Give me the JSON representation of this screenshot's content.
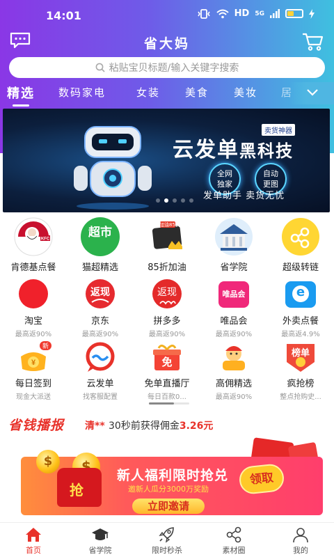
{
  "status_bar": {
    "time": "14:01",
    "network": "HD",
    "signal": "5G"
  },
  "header": {
    "title": "省大妈"
  },
  "search": {
    "placeholder": "粘贴宝贝标题/输入关键字搜索"
  },
  "categories": [
    {
      "label": "精选",
      "active": true
    },
    {
      "label": "数码家电"
    },
    {
      "label": "女装"
    },
    {
      "label": "美食"
    },
    {
      "label": "美妆"
    },
    {
      "label": "居"
    }
  ],
  "banner": {
    "title_a": "云发单",
    "title_b": "黑科技",
    "tag": "卖货神器",
    "badge1_line1": "全网",
    "badge1_line2": "独家",
    "badge2_line1": "自动",
    "badge2_line2": "更图",
    "subtitle": "发单助手  卖货无忧",
    "slide_count": 5,
    "active_slide": 1
  },
  "grid": [
    {
      "label": "肯德基点餐",
      "icon": "kfc-icon"
    },
    {
      "label": "猫超精选",
      "icon": "tmall-supermarket-icon",
      "icon_text": "超市"
    },
    {
      "label": "85折加油",
      "icon": "fuel-card-icon",
      "icon_text": "加油85折"
    },
    {
      "label": "省学院",
      "icon": "academy-icon"
    },
    {
      "label": "超级转链",
      "icon": "share-link-icon"
    },
    {
      "label": "淘宝",
      "sub": "最高返90%",
      "icon": "taobao-icon"
    },
    {
      "label": "京东",
      "sub": "最高返90%",
      "icon": "jd-icon",
      "icon_text": "返现"
    },
    {
      "label": "拼多多",
      "sub": "最高返90%",
      "icon": "pdd-icon",
      "icon_text": "返现"
    },
    {
      "label": "唯品会",
      "sub": "最高返90%",
      "icon": "vip-icon",
      "icon_text": "唯品会"
    },
    {
      "label": "外卖点餐",
      "sub": "最高返4.9%",
      "icon": "eleme-icon",
      "icon_text": "e"
    },
    {
      "label": "每日签到",
      "sub": "现金大派送",
      "icon": "signin-icon",
      "icon_text": "新"
    },
    {
      "label": "云发单",
      "sub": "找客服配置",
      "icon": "cloud-send-icon"
    },
    {
      "label": "免单直播厅",
      "sub": "每日百款0...",
      "icon": "free-gift-icon",
      "icon_text": "免"
    },
    {
      "label": "高佣精选",
      "sub": "最高返90%",
      "icon": "high-commission-icon"
    },
    {
      "label": "疯抢榜",
      "sub": "整点抢购史...",
      "icon": "ranking-icon",
      "icon_text": "榜单"
    }
  ],
  "ticker": {
    "logo": "省钱播报",
    "user": "清**",
    "text": "30秒前获得佣金",
    "amount": "3.26元"
  },
  "promo": {
    "title": "新人福利限时抢兑",
    "subtitle": "邀新人瓜分3000万奖励",
    "button": "立即邀请",
    "claim": "领取",
    "bag_label": "抢"
  },
  "tabbar": [
    {
      "label": "首页",
      "icon": "home-icon",
      "active": true
    },
    {
      "label": "省学院",
      "icon": "graduation-cap-icon"
    },
    {
      "label": "限时秒杀",
      "icon": "rocket-icon"
    },
    {
      "label": "素材圈",
      "icon": "share-circle-icon"
    },
    {
      "label": "我的",
      "icon": "user-icon"
    }
  ],
  "colors": {
    "gradient_start": "#8a37e6",
    "gradient_end": "#3fc0e0",
    "accent_red": "#e8322a"
  }
}
